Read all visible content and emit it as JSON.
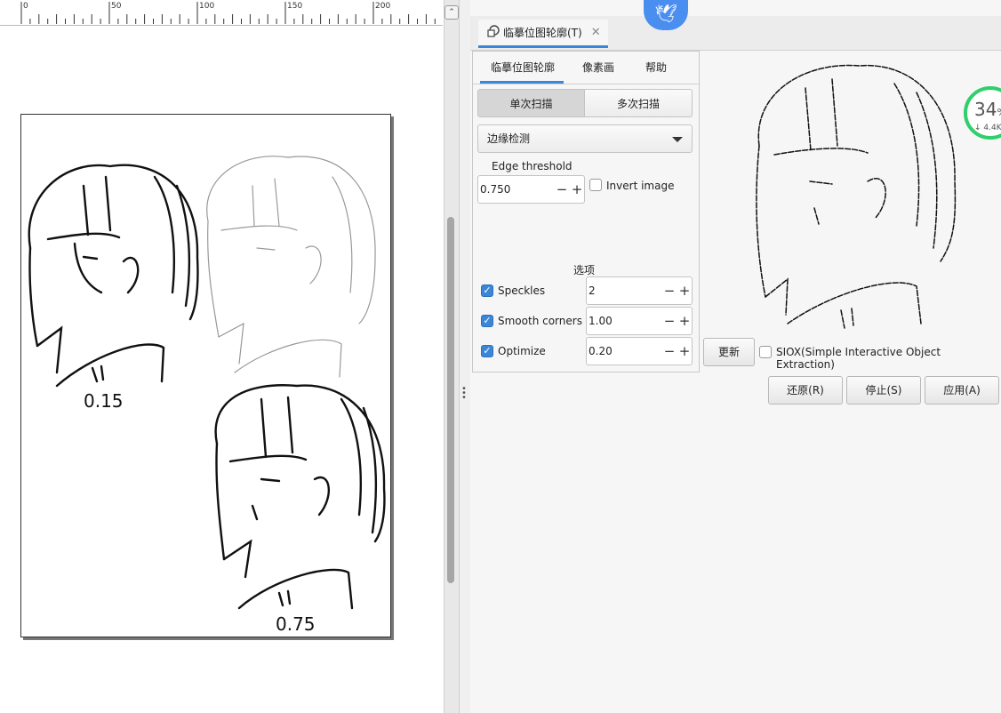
{
  "ruler": {
    "ticks": [
      "0",
      "50",
      "100",
      "150",
      "200"
    ]
  },
  "canvas": {
    "labels": [
      "0.15",
      "0.75"
    ]
  },
  "scroll_top_glyph": "⌃",
  "dock": {
    "tab_label": "临摹位图轮廓(T)"
  },
  "dialog": {
    "tabs": [
      "临摹位图轮廓",
      "像素画",
      "帮助"
    ],
    "scan_modes": [
      "单次扫描",
      "多次扫描"
    ],
    "method": "边缘检测",
    "edge_threshold_label": "Edge threshold",
    "edge_threshold_value": "0.750",
    "invert_label": "Invert image",
    "options_heading": "选项",
    "speckles_label": "Speckles",
    "speckles_value": "2",
    "smooth_label": "Smooth corners",
    "smooth_value": "1.00",
    "optimize_label": "Optimize",
    "optimize_value": "0.20",
    "minus": "−",
    "plus": "+"
  },
  "buttons": {
    "update": "更新",
    "siox": "SIOX(Simple Interactive Object Extraction)",
    "reset": "还原(R)",
    "stop": "停止(S)",
    "apply": "应用(A)"
  },
  "badge": {
    "percent": "34",
    "unit": "%",
    "rate": "↓ 4.4K/"
  },
  "colors": {
    "accent": "#3a86d8",
    "badge_green": "#2fcf6a"
  }
}
